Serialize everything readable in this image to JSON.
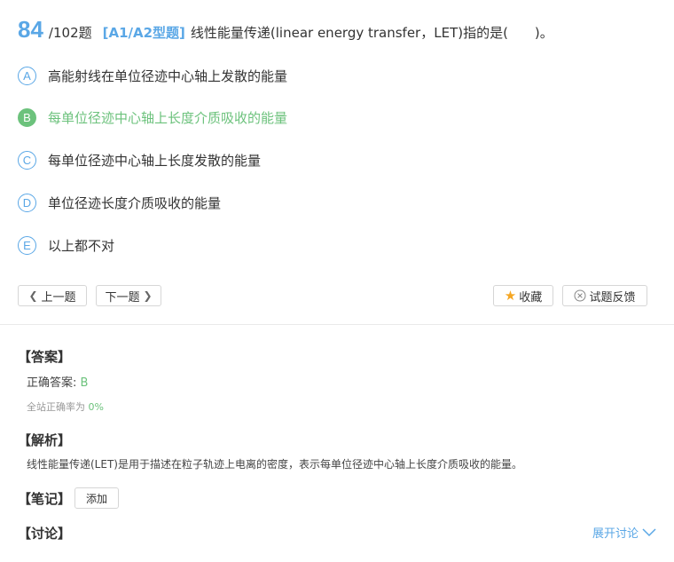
{
  "question": {
    "number": "84",
    "total": "/102题",
    "type": "[A1/A2型题]",
    "text": "线性能量传递(linear energy transfer，LET)指的是(　　)。"
  },
  "options": [
    {
      "letter": "A",
      "text": "高能射线在单位径迹中心轴上发散的能量"
    },
    {
      "letter": "B",
      "text": "每单位径迹中心轴上长度介质吸收的能量"
    },
    {
      "letter": "C",
      "text": "每单位径迹中心轴上长度发散的能量"
    },
    {
      "letter": "D",
      "text": "单位径迹长度介质吸收的能量"
    },
    {
      "letter": "E",
      "text": "以上都不对"
    }
  ],
  "nav": {
    "prev_label": "上一题",
    "next_label": "下一题",
    "favorite_label": "收藏",
    "feedback_label": "试题反馈"
  },
  "answer": {
    "title": "【答案】",
    "label": "正确答案: ",
    "value": "B",
    "rate_label": "全站正确率为 ",
    "rate_value": "0%"
  },
  "analysis": {
    "title": "【解析】",
    "text": "线性能量传递(LET)是用于描述在粒子轨迹上电离的密度，表示每单位径迹中心轴上长度介质吸收的能量。"
  },
  "notes": {
    "title": "【笔记】",
    "add_label": "添加"
  },
  "discussion": {
    "title": "【讨论】",
    "expand_label": "展开讨论"
  },
  "colors": {
    "accent": "#5aa7e6",
    "correct": "#6cc27c",
    "star": "#f5a623"
  }
}
